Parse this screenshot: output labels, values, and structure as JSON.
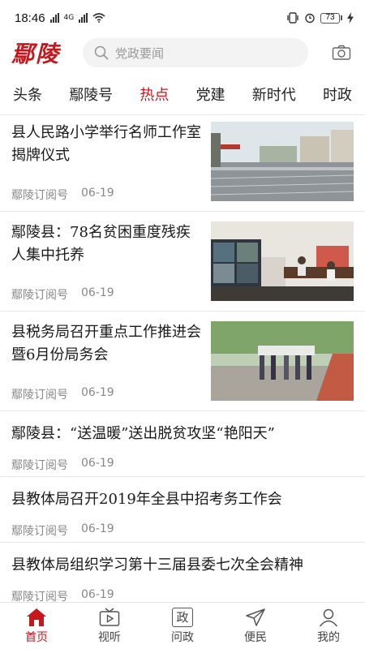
{
  "status_bar": {
    "time": "18:46",
    "network": "4G",
    "battery": "73"
  },
  "header": {
    "logo": "鄢陵",
    "search_placeholder": "党政要闻",
    "brand_color": "#c8161d"
  },
  "tabs": [
    {
      "label": "头条",
      "active": false
    },
    {
      "label": "鄢陵号",
      "active": false
    },
    {
      "label": "热点",
      "active": true
    },
    {
      "label": "党建",
      "active": false
    },
    {
      "label": "新时代",
      "active": false
    },
    {
      "label": "时政",
      "active": false
    }
  ],
  "articles": [
    {
      "title": "县人民路小学举行名师工作室揭牌仪式",
      "source": "鄢陵订阅号",
      "date": "06-19",
      "image": "school-gate-photo"
    },
    {
      "title": "鄢陵县：78名贫困重度残疾人集中托养",
      "source": "鄢陵订阅号",
      "date": "06-19",
      "image": "monitoring-room-photo"
    },
    {
      "title": "县税务局召开重点工作推进会暨6月份局务会",
      "source": "鄢陵订阅号",
      "date": "06-19",
      "image": "officials-walking-photo"
    },
    {
      "title": "鄢陵县：“送温暖”送出脱贫攻坚“艳阳天”",
      "source": "鄢陵订阅号",
      "date": "06-19"
    },
    {
      "title": "县教体局召开2019年全县中招考务工作会",
      "source": "鄢陵订阅号",
      "date": "06-19"
    },
    {
      "title": "县教体局组织学习第十三届县委七次全会精神",
      "source": "鄢陵订阅号",
      "date": "06-19"
    }
  ],
  "bottom_nav": [
    {
      "label": "首页",
      "icon": "home-icon",
      "active": true
    },
    {
      "label": "视听",
      "icon": "tv-icon",
      "active": false
    },
    {
      "label": "问政",
      "icon": "politics-icon",
      "active": false,
      "glyph": "政"
    },
    {
      "label": "便民",
      "icon": "send-icon",
      "active": false
    },
    {
      "label": "我的",
      "icon": "user-icon",
      "active": false
    }
  ]
}
